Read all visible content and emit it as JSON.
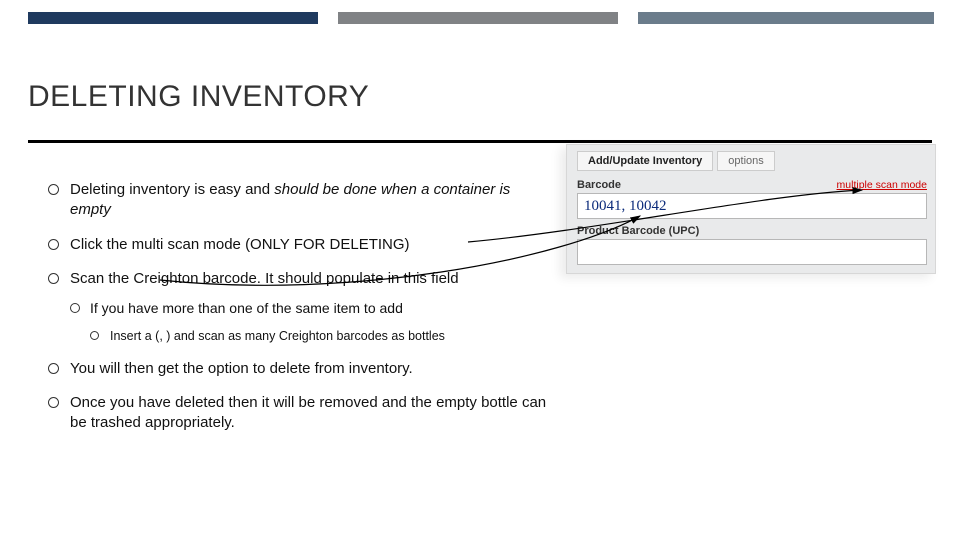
{
  "title": "DELETING INVENTORY",
  "bullets": {
    "b1_a": "Deleting inventory is easy and ",
    "b1_b": "should be done when a container is empty",
    "b2": "Click the multi scan mode (ONLY FOR DELETING)",
    "b3": "Scan the Creighton barcode. It should populate in this field",
    "b3_1": "If you have more than one of the same item to add",
    "b3_1_1": "Insert a (, ) and scan as many Creighton barcodes as bottles",
    "b4": "You will then get the option to delete from inventory.",
    "b5": "Once you have deleted then it will be removed and the empty bottle can be trashed appropriately."
  },
  "panel": {
    "tab_main": "Add/Update Inventory",
    "tab_options": "options",
    "barcode_label": "Barcode",
    "multi_scan": "multiple scan mode",
    "barcode_value": "10041, 10042",
    "upc_label": "Product Barcode (UPC)",
    "upc_value": ""
  }
}
